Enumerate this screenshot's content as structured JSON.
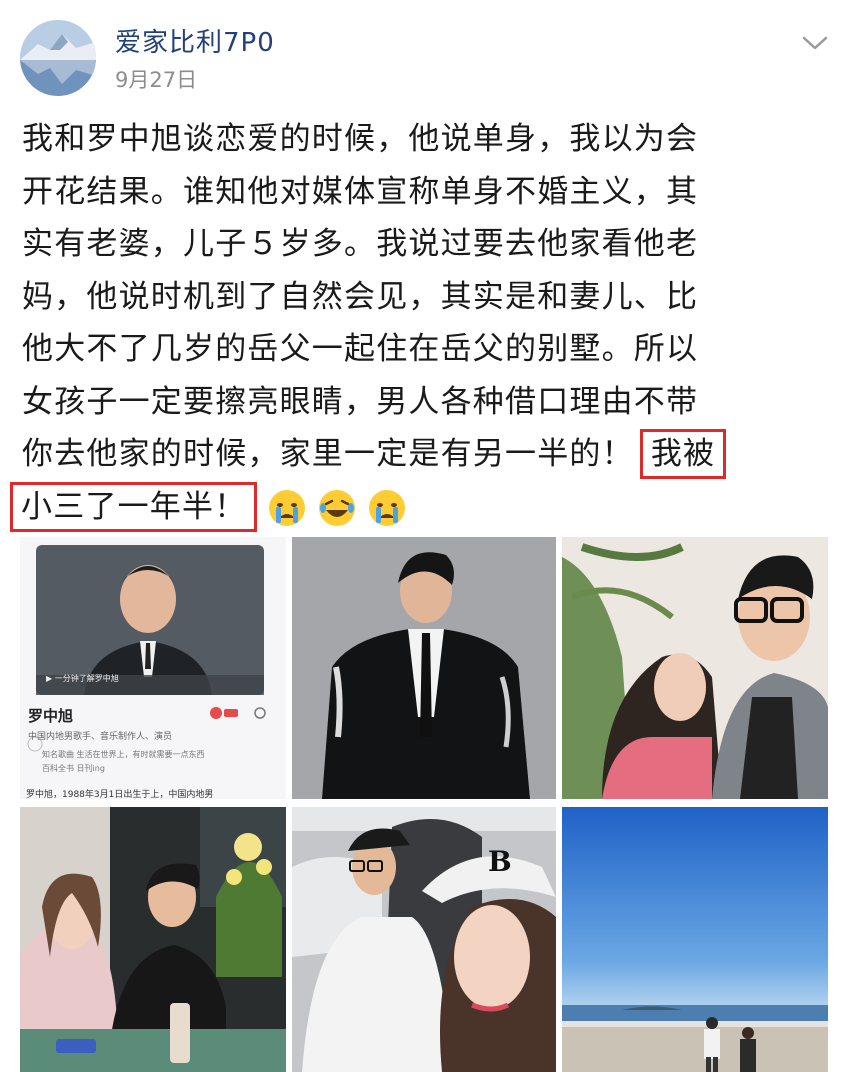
{
  "post": {
    "username": "爱家比利7P0",
    "date": "9月27日",
    "lines": [
      "我和罗中旭谈恋爱的时候，他说单身，我以为会",
      "开花结果。谁知他对媒体宣称单身不婚主义，其",
      "实有老婆，儿子５岁多。我说过要去他家看他老",
      "妈，他说时机到了自然会见，其实是和妻儿、比",
      "他大不了几岁的岳父一起住在岳父的别墅。所以",
      "女孩子一定要擦亮眼睛，男人各种借口理由不带"
    ],
    "line7_plain": "你去他家的时候，家里一定是有另一半的！",
    "line7_highlight": "我被",
    "line8_highlight": "小三了一年半！",
    "emojis": [
      "crying-face",
      "laughing-tears-face",
      "crying-face"
    ],
    "highlight_color": "#dd2a2a"
  },
  "images": {
    "card": {
      "title": "罗中旭",
      "subtitle": "中国内地男歌手、音乐制作人、演员",
      "row1": "知名歌曲  生活在世界上，有时就需要一点东西",
      "row2": "百科全书  日刊ing",
      "footer": "罗中旭，1988年3月1日出生于上，中国内地男"
    }
  },
  "colors": {
    "username": "#23407a",
    "date": "#8d8d8d",
    "text": "#1a1a1a"
  }
}
